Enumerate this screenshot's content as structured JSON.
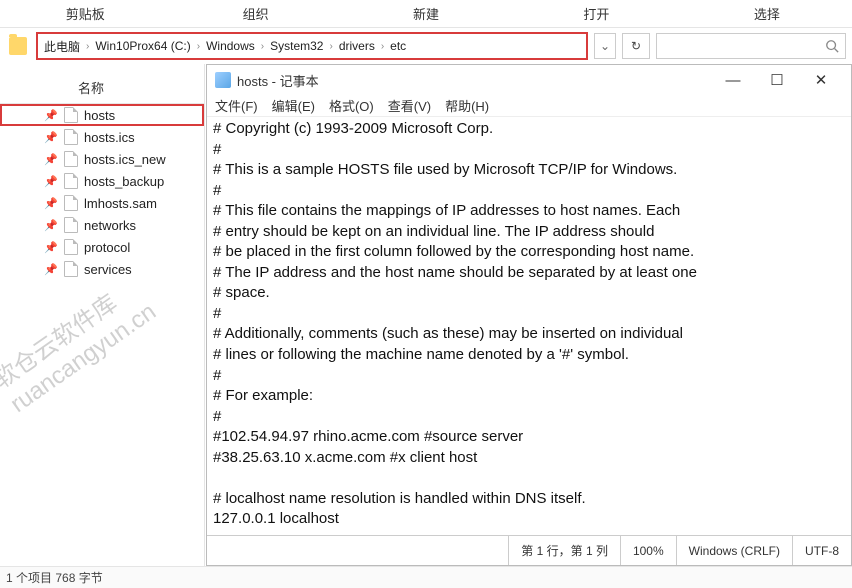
{
  "toolbar": {
    "clipboard": "剪贴板",
    "organize": "组织",
    "new": "新建",
    "open": "打开",
    "select": "选择"
  },
  "breadcrumb": [
    "此电脑",
    "Win10Prox64 (C:)",
    "Windows",
    "System32",
    "drivers",
    "etc"
  ],
  "column_header": "名称",
  "files": [
    {
      "name": "hosts",
      "selected": true
    },
    {
      "name": "hosts.ics"
    },
    {
      "name": "hosts.ics_new"
    },
    {
      "name": "hosts_backup"
    },
    {
      "name": "lmhosts.sam"
    },
    {
      "name": "networks"
    },
    {
      "name": "protocol"
    },
    {
      "name": "services"
    }
  ],
  "watermark": {
    "line1": "软仓云软件库",
    "line2": "ruancangyun.cn"
  },
  "notepad": {
    "title": "hosts - 记事本",
    "menu": {
      "file": "文件(F)",
      "edit": "编辑(E)",
      "format": "格式(O)",
      "view": "查看(V)",
      "help": "帮助(H)"
    },
    "content": "# Copyright (c) 1993-2009 Microsoft Corp.\n#\n# This is a sample HOSTS file used by Microsoft TCP/IP for Windows.\n#\n# This file contains the mappings of IP addresses to host names. Each\n# entry should be kept on an individual line. The IP address should\n# be placed in the first column followed by the corresponding host name.\n# The IP address and the host name should be separated by at least one\n# space.\n#\n# Additionally, comments (such as these) may be inserted on individual\n# lines or following the machine name denoted by a '#' symbol.\n#\n# For example:\n#\n#102.54.94.97 rhino.acme.com #source server\n#38.25.63.10 x.acme.com #x client host\n\n# localhost name resolution is handled within DNS itself.\n127.0.0.1 localhost",
    "status": {
      "pos": "第 1 行，第 1 列",
      "zoom": "100%",
      "eol": "Windows (CRLF)",
      "enc": "UTF-8"
    }
  },
  "explorer_status": "1 个项目  768 字节"
}
